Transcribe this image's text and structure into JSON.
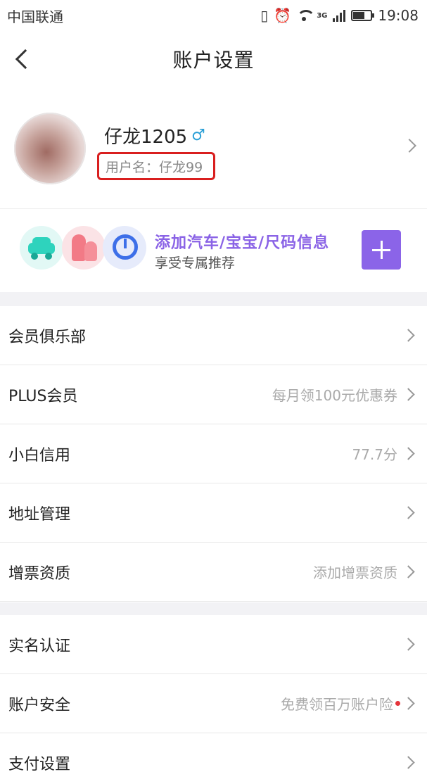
{
  "status_bar": {
    "carrier": "中国联通",
    "network": "3G",
    "time": "19:08"
  },
  "header": {
    "title": "账户设置"
  },
  "profile": {
    "nickname": "仔龙1205",
    "gender_icon": "♂",
    "username": "用户名：仔龙99"
  },
  "banner": {
    "title": "添加汽车/宝宝/尺码信息",
    "subtitle": "享受专属推荐",
    "icons": [
      "car-icon",
      "baby-icon",
      "size-icon"
    ]
  },
  "rows_group1": [
    {
      "label": "会员俱乐部",
      "value": ""
    },
    {
      "label": "PLUS会员",
      "value": "每月领100元优惠券"
    },
    {
      "label": "小白信用",
      "value": "77.7分"
    },
    {
      "label": "地址管理",
      "value": ""
    },
    {
      "label": "增票资质",
      "value": "添加增票资质"
    }
  ],
  "rows_group2": [
    {
      "label": "实名认证",
      "value": ""
    },
    {
      "label": "账户安全",
      "value": "免费领百万账户险"
    },
    {
      "label": "支付设置",
      "value": ""
    }
  ],
  "colors": {
    "accent_purple": "#8b64e8",
    "highlight_red": "#d91f1f",
    "male_blue": "#2a9fd6"
  }
}
